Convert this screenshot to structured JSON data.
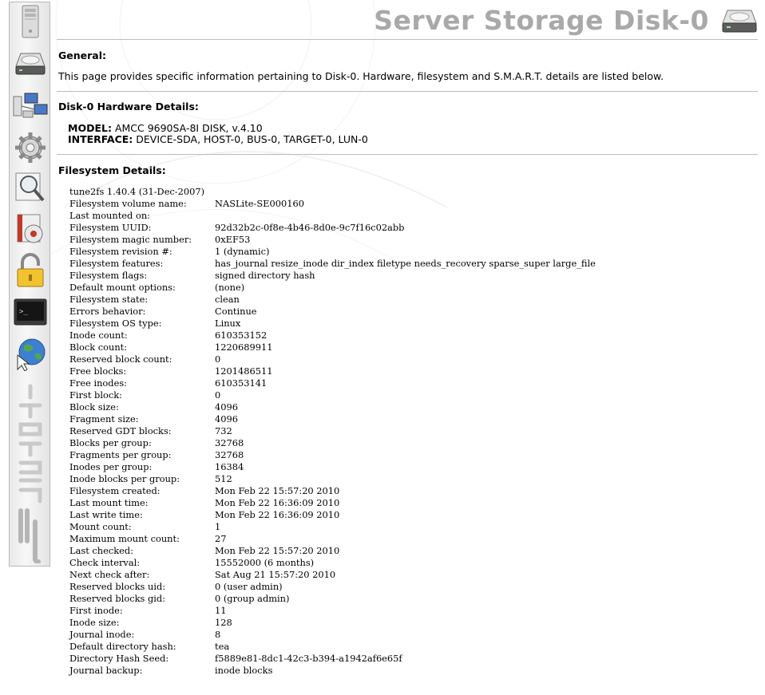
{
  "header": {
    "title": "Server Storage Disk-0"
  },
  "sidebar": {
    "items": [
      {
        "name": "server-icon"
      },
      {
        "name": "storage-disk-icon"
      },
      {
        "name": "network-computers-icon"
      },
      {
        "name": "settings-gear-icon"
      },
      {
        "name": "magnifier-search-icon"
      },
      {
        "name": "cd-media-icon"
      },
      {
        "name": "padlock-icon"
      },
      {
        "name": "terminal-icon"
      },
      {
        "name": "globe-web-icon"
      }
    ]
  },
  "general": {
    "heading": "General:",
    "text": "This page provides specific information pertaining to Disk-0. Hardware, filesystem and S.M.A.R.T. details are listed below."
  },
  "hardware": {
    "heading": "Disk-0 Hardware Details:",
    "model_label": "MODEL:",
    "model_value": "AMCC 9690SA-8I DISK, v.4.10",
    "interface_label": "INTERFACE:",
    "interface_value": "DEVICE-SDA, HOST-0, BUS-0, TARGET-0, LUN-0"
  },
  "filesystem": {
    "heading": "Filesystem Details:",
    "version_line": "tune2fs 1.40.4 (31-Dec-2007)",
    "rows": [
      {
        "key": "Filesystem volume name:",
        "value": "NASLite-SE000160"
      },
      {
        "key": "Last mounted on:",
        "value": ""
      },
      {
        "key": "Filesystem UUID:",
        "value": "92d32b2c-0f8e-4b46-8d0e-9c7f16c02abb"
      },
      {
        "key": "Filesystem magic number:",
        "value": "0xEF53"
      },
      {
        "key": "Filesystem revision #:",
        "value": "1 (dynamic)"
      },
      {
        "key": "Filesystem features:",
        "value": "has_journal resize_inode dir_index filetype needs_recovery sparse_super large_file"
      },
      {
        "key": "Filesystem flags:",
        "value": "signed directory hash"
      },
      {
        "key": "Default mount options:",
        "value": "(none)"
      },
      {
        "key": "Filesystem state:",
        "value": "clean"
      },
      {
        "key": "Errors behavior:",
        "value": "Continue"
      },
      {
        "key": "Filesystem OS type:",
        "value": "Linux"
      },
      {
        "key": "Inode count:",
        "value": "610353152"
      },
      {
        "key": "Block count:",
        "value": "1220689911"
      },
      {
        "key": "Reserved block count:",
        "value": "0"
      },
      {
        "key": "Free blocks:",
        "value": "1201486511"
      },
      {
        "key": "Free inodes:",
        "value": "610353141"
      },
      {
        "key": "First block:",
        "value": "0"
      },
      {
        "key": "Block size:",
        "value": "4096"
      },
      {
        "key": "Fragment size:",
        "value": "4096"
      },
      {
        "key": "Reserved GDT blocks:",
        "value": "732"
      },
      {
        "key": "Blocks per group:",
        "value": "32768"
      },
      {
        "key": "Fragments per group:",
        "value": "32768"
      },
      {
        "key": "Inodes per group:",
        "value": "16384"
      },
      {
        "key": "Inode blocks per group:",
        "value": "512"
      },
      {
        "key": "Filesystem created:",
        "value": "Mon Feb 22 15:57:20 2010"
      },
      {
        "key": "Last mount time:",
        "value": "Mon Feb 22 16:36:09 2010"
      },
      {
        "key": "Last write time:",
        "value": "Mon Feb 22 16:36:09 2010"
      },
      {
        "key": "Mount count:",
        "value": "1"
      },
      {
        "key": "Maximum mount count:",
        "value": "27"
      },
      {
        "key": "Last checked:",
        "value": "Mon Feb 22 15:57:20 2010"
      },
      {
        "key": "Check interval:",
        "value": "15552000 (6 months)"
      },
      {
        "key": "Next check after:",
        "value": "Sat Aug 21 15:57:20 2010"
      },
      {
        "key": "Reserved blocks uid:",
        "value": "0 (user admin)"
      },
      {
        "key": "Reserved blocks gid:",
        "value": "0 (group admin)"
      },
      {
        "key": "First inode:",
        "value": "11"
      },
      {
        "key": "Inode size:",
        "value": "128"
      },
      {
        "key": "Journal inode:",
        "value": "8"
      },
      {
        "key": "Default directory hash:",
        "value": "tea"
      },
      {
        "key": "Directory Hash Seed:",
        "value": "f5889e81-8dc1-42c3-b394-a1942af6e65f"
      },
      {
        "key": "Journal backup:",
        "value": "inode blocks"
      }
    ]
  },
  "colors": {
    "title": "#a9a9a9",
    "rule": "#bdbdbd",
    "sidebar_bg": "#eeeeee"
  }
}
